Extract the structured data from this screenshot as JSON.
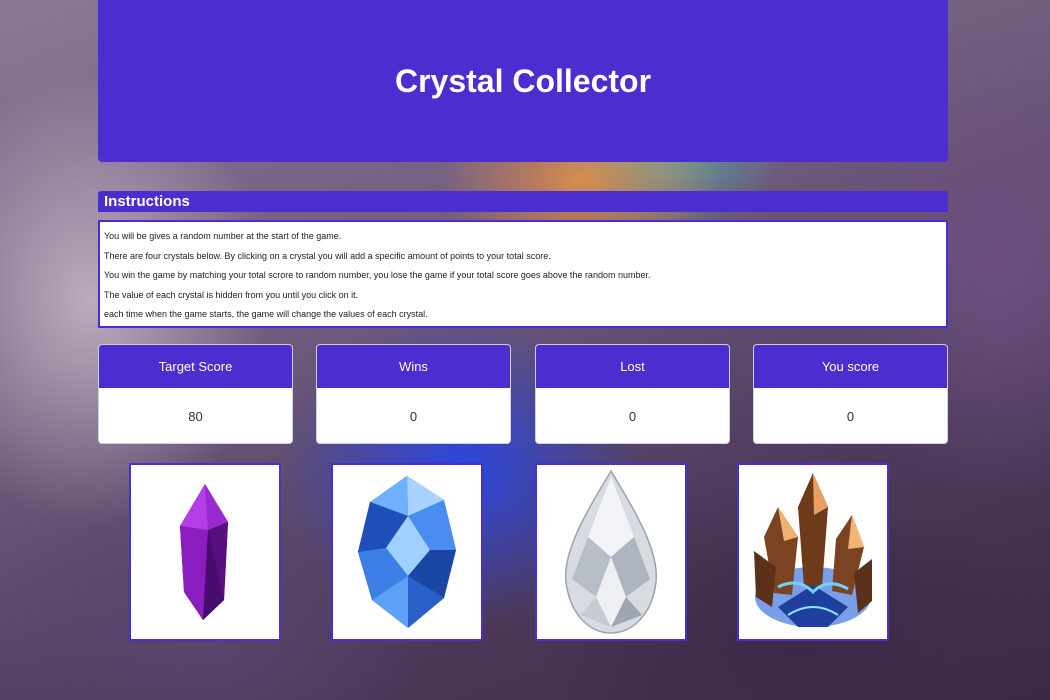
{
  "header": {
    "title": "Crystal Collector"
  },
  "instructions": {
    "heading": "Instructions",
    "lines": [
      "You will be gives a random number at the start of the game.",
      "There are four crystals below. By clicking on a crystal you will add a specific amount of points to your total score.",
      "You win the game by matching your total scrore to random number, you lose the game if your total score goes above the random number.",
      "The value of each crystal is hidden from you until you click on it.",
      "each time when the game starts, the game will change the values of each crystal."
    ]
  },
  "stats": [
    {
      "label": "Target Score",
      "value": "80"
    },
    {
      "label": "Wins",
      "value": "0"
    },
    {
      "label": "Lost",
      "value": "0"
    },
    {
      "label": "You score",
      "value": "0"
    }
  ],
  "crystals": [
    {
      "icon": "purple-crystal-icon",
      "color": "#7a12a8"
    },
    {
      "icon": "blue-crystal-icon",
      "color": "#2a6fd8"
    },
    {
      "icon": "clear-teardrop-crystal-icon",
      "color": "#d9dde3"
    },
    {
      "icon": "amber-blue-crystal-cluster-icon",
      "color": "#c8722e"
    }
  ],
  "colors": {
    "accent": "#4b2dd0"
  }
}
